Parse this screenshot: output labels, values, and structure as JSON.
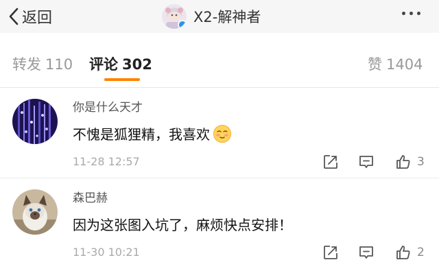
{
  "nav": {
    "back_label": "返回",
    "title": "X2-解神者"
  },
  "tabs": {
    "repost_label": "转发",
    "repost_count": "110",
    "comment_label": "评论",
    "comment_count": "302",
    "like_label": "赞",
    "like_count": "1404",
    "active": "comment"
  },
  "comments": [
    {
      "user": "你是什么天才",
      "text": "不愧是狐狸精，我喜欢",
      "emoji": "shy-face-emoji",
      "time": "11-28 12:57",
      "likes": "3"
    },
    {
      "user": "森巴赫",
      "text": "因为这张图入坑了，麻烦快点安排！",
      "time": "11-30 10:21",
      "likes": "2"
    }
  ],
  "icons": {
    "back": "chevron-left-icon",
    "more": "more-dots-icon",
    "share": "share-icon",
    "reply": "comment-icon",
    "like": "thumbs-up-icon"
  },
  "colors": {
    "accent": "#ff8200",
    "verify": "#2f93e8",
    "nav_bg": "#f6f6f6"
  }
}
